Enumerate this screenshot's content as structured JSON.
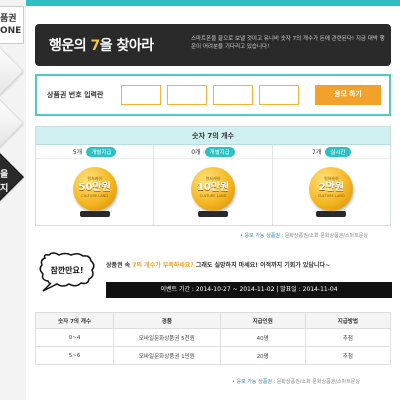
{
  "sidebar": {
    "box_line1": "품권",
    "box_line2": "ONE",
    "dark_label": "을 지"
  },
  "banner": {
    "title_pre": "행운의 ",
    "title_num": "7",
    "title_post": "을 찾아라",
    "desc": "스마트폰을 끝으로 보낼 것이고 유니비 숫자 7의 개수가 돈에 관련된다! 지금 대박 행운이 어려분을 기다리고 있습니다!"
  },
  "code_input": {
    "label": "상품권 번호 입력란",
    "fields": [
      "",
      "",
      "",
      ""
    ],
    "apply_label": "응모 하기"
  },
  "prize": {
    "header": "숫자 7의 개수",
    "cols": [
      {
        "count": "5개",
        "pill": "개별지급",
        "coin_top": "컬쳐캐쉬",
        "amount": "50만원",
        "brand": "CULTURE LAND"
      },
      {
        "count": "0개",
        "pill": "개별지급",
        "coin_top": "컬쳐캐쉬",
        "amount": "10만원",
        "brand": "CULTURE LAND"
      },
      {
        "count": "7개",
        "pill": "실시간",
        "coin_top": "컬쳐캐쉬",
        "amount": "2만원",
        "brand": "CULTURE LAND"
      }
    ]
  },
  "note1": {
    "pre": "• 응모 가능 상품권 : ",
    "text": "문화상품권/소화 문화상품권/스마트문상"
  },
  "event": {
    "bubble": "잠깐만요!",
    "line_pre": "상품권 속 ",
    "line_hl": "7의 개수가 부족하세요?",
    "line_post": " 그래도 실망하지 마세요! 이적까지 기회가 있답니다~",
    "period": "이벤트 기간 : 2014-10-27 ~ 2014-11-02  |  발표일 : 2014-11-04"
  },
  "result": {
    "headers": [
      "숫자 7의 개수",
      "경품",
      "지급인원",
      "지급방법"
    ],
    "rows": [
      [
        "0~4",
        "모바일문화상품권 5천원",
        "40명",
        "추첨"
      ],
      [
        "5~6",
        "모바일문화상품권 1만원",
        "20명",
        "추첨"
      ]
    ]
  },
  "note2": {
    "pre": "• 응모 가능 상품권 : ",
    "text": "문화상품권/소화 문화상품권/스마트문상"
  },
  "colors": {
    "teal": "#2bc0c4",
    "orange": "#f2a12a",
    "dark": "#2a2a2a",
    "gold": "#f2b21c"
  }
}
